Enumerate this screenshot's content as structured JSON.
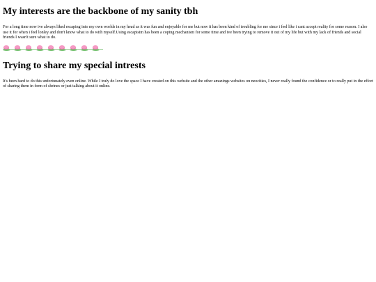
{
  "page": {
    "heading_1": "My interests are the backbone of my sanity tbh",
    "paragraph_1": "For a long time now ive always liked escaping into my own worlds in my head as it was fun and enjoyable for me but now it has been kind of troubling for me since i feel like i cant accept reality for some reason. I also use it for when i feel lonley and don't know what to do with myself.Using escapisim has been a coping mechanism for some time and ive been trying to remove it out of my life but with my lack of friends and social friends I wasn't sure what to do.",
    "divider": {
      "icon": "pink-flower-icon",
      "count": 9,
      "colors": {
        "bloom": "#f59ac4",
        "leaf": "#6fbf6a"
      }
    },
    "heading_2": "Trying to share my special intrests",
    "paragraph_2": "It's been hard to do this unfortunately even online. While I truly do love the space I have created on this website and the other amazings websites on neocities, I never really found the confidence or to really put in the effort of sharing them in form of shrines or just talking about it online."
  }
}
